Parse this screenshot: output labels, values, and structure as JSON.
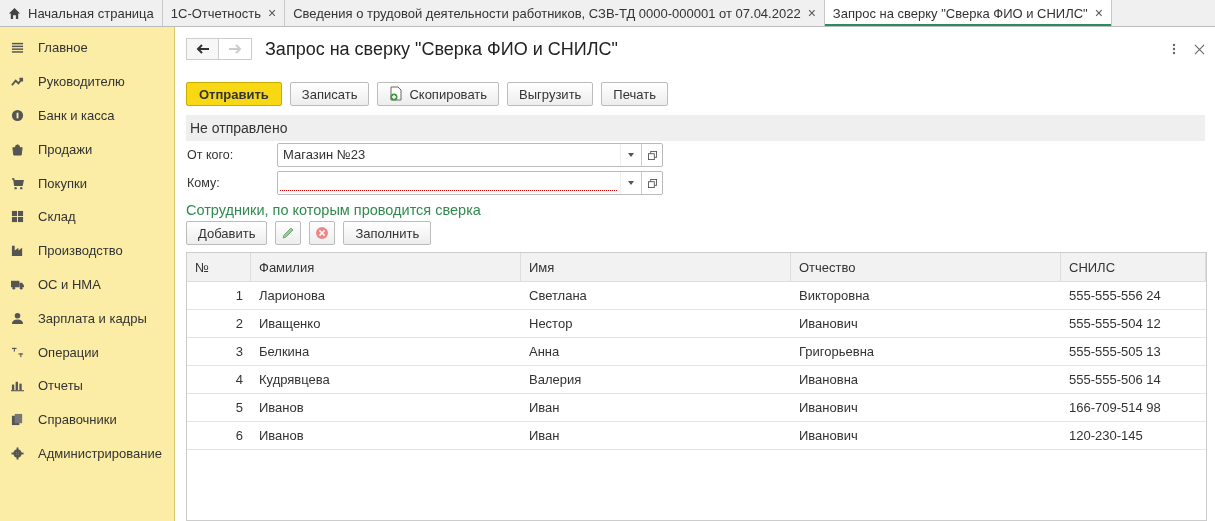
{
  "tabs": [
    {
      "label": "Начальная страница",
      "selected": false,
      "closable": false,
      "home": true
    },
    {
      "label": "1С-Отчетность",
      "selected": false,
      "closable": true,
      "home": false
    },
    {
      "label": "Сведения о трудовой деятельности работников, СЗВ-ТД 0000-000001 от 07.04.2022",
      "selected": false,
      "closable": true,
      "home": false
    },
    {
      "label": "Запрос на сверку \"Сверка ФИО и СНИЛС\"",
      "selected": true,
      "closable": true,
      "home": false
    }
  ],
  "close_char": "×",
  "sidebar": {
    "items": [
      {
        "label": "Главное"
      },
      {
        "label": "Руководителю"
      },
      {
        "label": "Банк и касса"
      },
      {
        "label": "Продажи"
      },
      {
        "label": "Покупки"
      },
      {
        "label": "Склад"
      },
      {
        "label": "Производство"
      },
      {
        "label": "ОС и НМА"
      },
      {
        "label": "Зарплата и кадры"
      },
      {
        "label": "Операции"
      },
      {
        "label": "Отчеты"
      },
      {
        "label": "Справочники"
      },
      {
        "label": "Администрирование"
      }
    ]
  },
  "form": {
    "title": "Запрос на сверку \"Сверка ФИО и СНИЛС\"",
    "toolbar": [
      {
        "label": "Отправить",
        "kind": "primary"
      },
      {
        "label": "Записать",
        "kind": "plain"
      },
      {
        "label": "Скопировать",
        "kind": "copy"
      },
      {
        "label": "Выгрузить",
        "kind": "plain"
      },
      {
        "label": "Печать",
        "kind": "plain"
      }
    ],
    "status": "Не отправлено",
    "fields": [
      {
        "label": "От кого:",
        "value": "Магазин №23"
      },
      {
        "label": "Кому:"
      }
    ],
    "section_title": "Сотрудники, по которым проводится сверка",
    "table_toolbar": [
      {
        "label": "Добавить",
        "kind": "text"
      },
      {
        "kind": "edit"
      },
      {
        "kind": "delete"
      },
      {
        "label": "Заполнить",
        "kind": "text"
      }
    ],
    "table": {
      "columns": [
        "№",
        "Фамилия",
        "Имя",
        "Отчество",
        "СНИЛС"
      ],
      "rows": [
        [
          "1",
          "Ларионова",
          "Светлана",
          "Викторовна",
          "555-555-556 24"
        ],
        [
          "2",
          "Иващенко",
          "Нестор",
          "Иванович",
          "555-555-504 12"
        ],
        [
          "3",
          "Белкина",
          "Анна",
          "Григорьевна",
          "555-555-505 13"
        ],
        [
          "4",
          "Кудрявцева",
          "Валерия",
          "Ивановна",
          "555-555-506 14"
        ],
        [
          "5",
          "Иванов",
          "Иван",
          "Иванович",
          "166-709-514 98"
        ],
        [
          "6",
          "Иванов",
          "Иван",
          "Иванович",
          "120-230-145"
        ]
      ]
    }
  }
}
